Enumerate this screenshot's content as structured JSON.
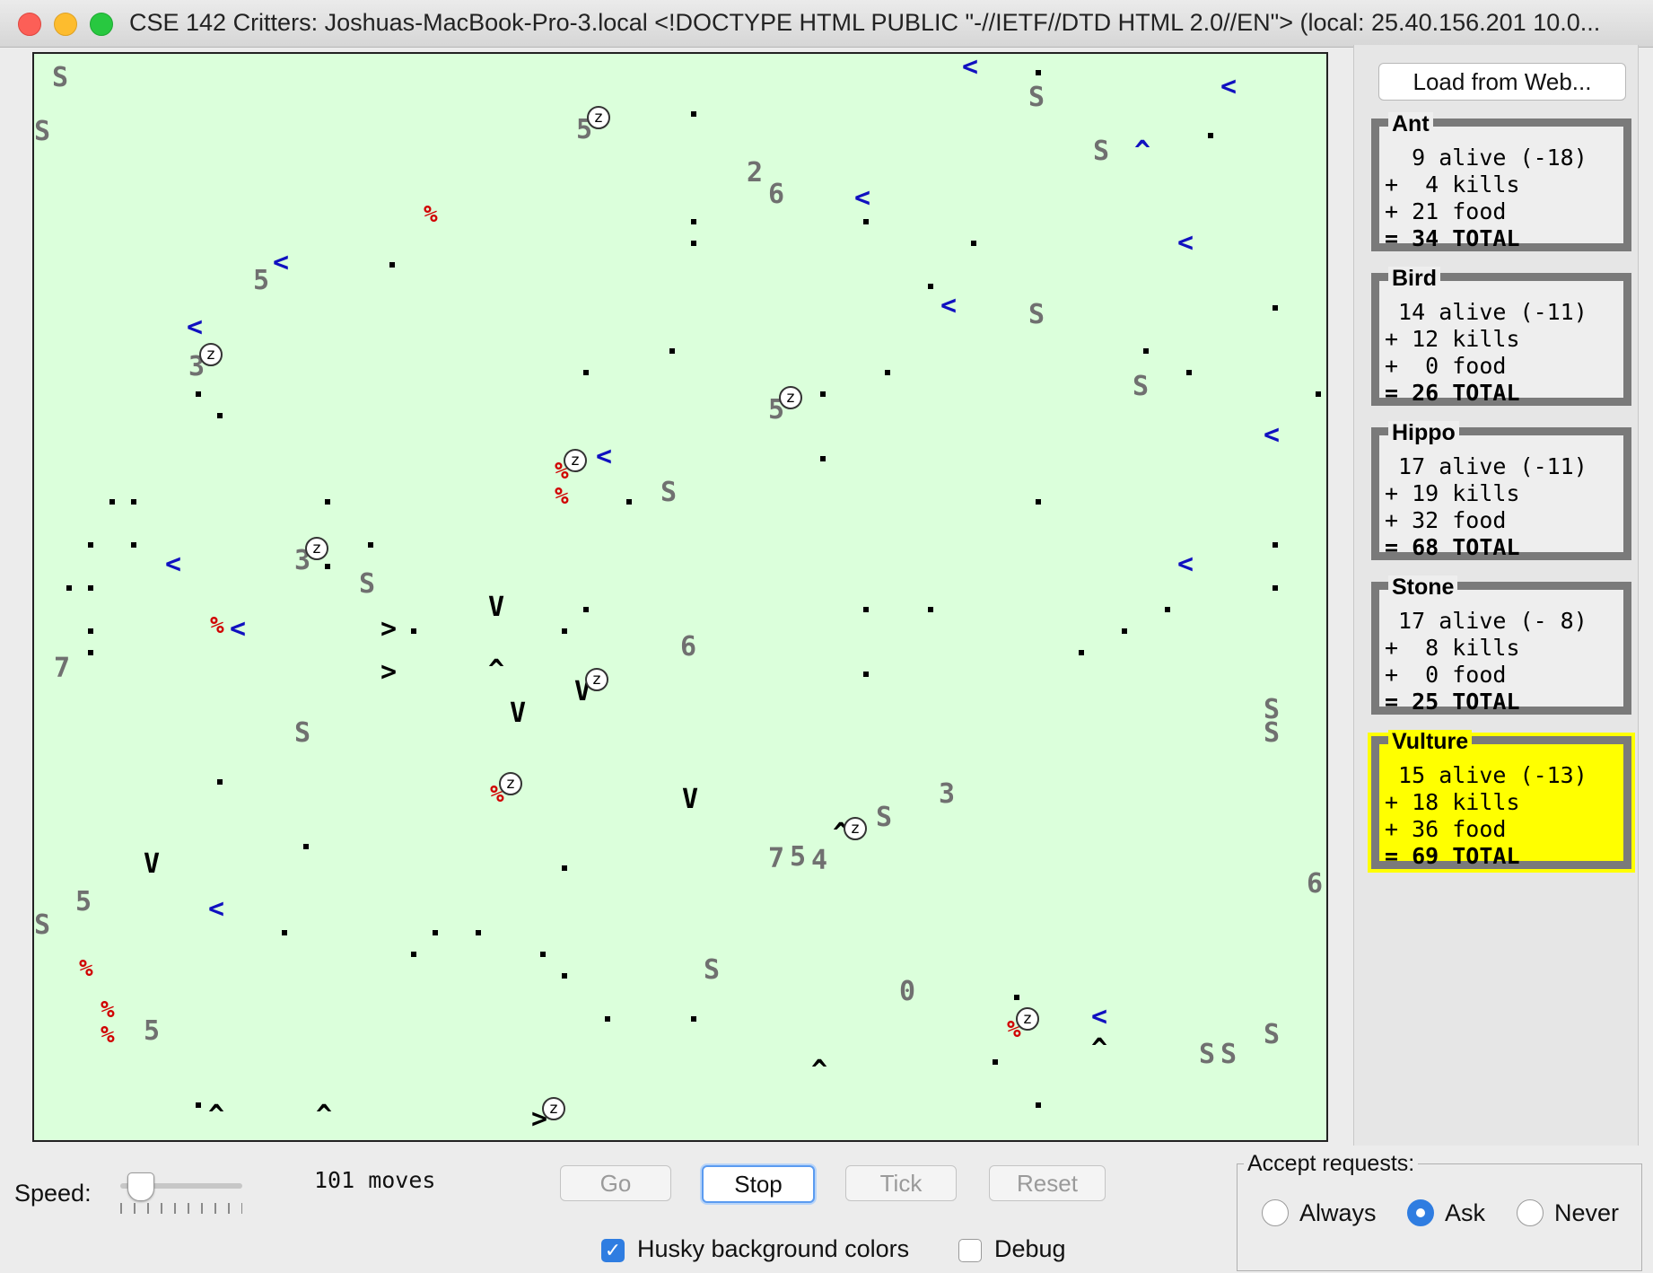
{
  "window": {
    "title": "CSE 142 Critters: Joshuas-MacBook-Pro-3.local <!DOCTYPE HTML PUBLIC \"-//IETF//DTD HTML 2.0//EN\">  (local: 25.40.156.201 10.0..."
  },
  "sidebar": {
    "load_button": "Load from Web...",
    "panels": [
      {
        "name": "Ant",
        "alive": "  9 alive (-18)",
        "kills": "+  4 kills",
        "food": "+ 21 food",
        "total": "= 34 TOTAL"
      },
      {
        "name": "Bird",
        "alive": " 14 alive (-11)",
        "kills": "+ 12 kills",
        "food": "+  0 food",
        "total": "= 26 TOTAL"
      },
      {
        "name": "Hippo",
        "alive": " 17 alive (-11)",
        "kills": "+ 19 kills",
        "food": "+ 32 food",
        "total": "= 68 TOTAL"
      },
      {
        "name": "Stone",
        "alive": " 17 alive (- 8)",
        "kills": "+  8 kills",
        "food": "+  0 food",
        "total": "= 25 TOTAL"
      },
      {
        "name": "Vulture",
        "alive": " 15 alive (-13)",
        "kills": "+ 18 kills",
        "food": "+ 36 food",
        "total": "= 69 TOTAL"
      }
    ],
    "highlighted": "Vulture"
  },
  "controls": {
    "speed_label": "Speed:",
    "moves": "101 moves",
    "go": "Go",
    "stop": "Stop",
    "tick": "Tick",
    "reset": "Reset",
    "husky_label": "Husky background colors",
    "husky_checked": true,
    "debug_label": "Debug",
    "debug_checked": false
  },
  "accept": {
    "title": "Accept requests:",
    "options": [
      "Always",
      "Ask",
      "Never"
    ],
    "selected": "Ask"
  },
  "arena_glyphs": {
    "stone": "S",
    "ant": "%",
    "bird_west": "<",
    "bird_east": ">",
    "bird_north": "^",
    "vulture": "V",
    "sleep": "z",
    "zero": "0",
    "hippo_2": "2",
    "hippo_3": "3",
    "hippo_4": "4",
    "hippo_5": "5",
    "hippo_6": "6",
    "hippo_7": "7"
  },
  "colors": {
    "arena_bg": "#dbffdb",
    "stone": "#707070",
    "ant": "#d00000",
    "bird": "#1010c0",
    "highlight": "#ffff00"
  }
}
